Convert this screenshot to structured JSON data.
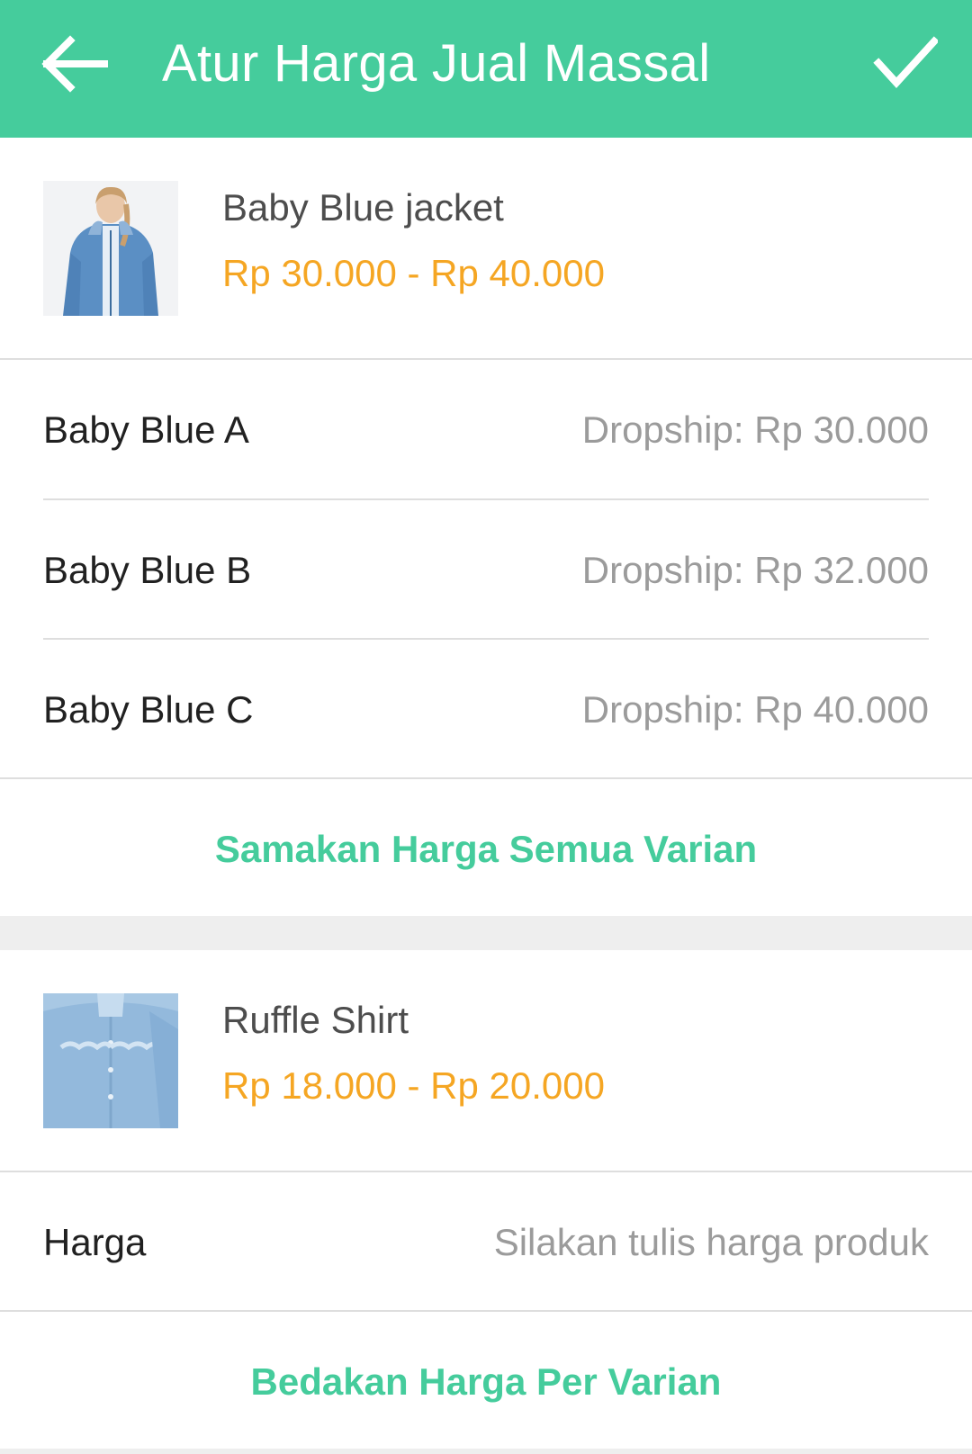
{
  "header": {
    "title": "Atur Harga Jual Massal",
    "back_icon": "back-arrow-icon",
    "confirm_icon": "check-icon"
  },
  "colors": {
    "primary": "#45cc9c",
    "price": "#f5a623",
    "muted": "#9b9b9b",
    "text": "#212121"
  },
  "products": [
    {
      "name": "Baby Blue jacket",
      "price_range": "Rp 30.000 - Rp 40.000",
      "variants": [
        {
          "label": "Baby Blue A",
          "value": "Dropship: Rp 30.000"
        },
        {
          "label": "Baby Blue B",
          "value": "Dropship: Rp 32.000"
        },
        {
          "label": "Baby Blue C",
          "value": "Dropship: Rp 40.000"
        }
      ],
      "action": "Samakan Harga Semua Varian"
    },
    {
      "name": "Ruffle Shirt",
      "price_range": "Rp 18.000 - Rp 20.000",
      "price_field": {
        "label": "Harga",
        "placeholder": "Silakan tulis harga produk"
      },
      "action": "Bedakan Harga Per Varian"
    }
  ]
}
